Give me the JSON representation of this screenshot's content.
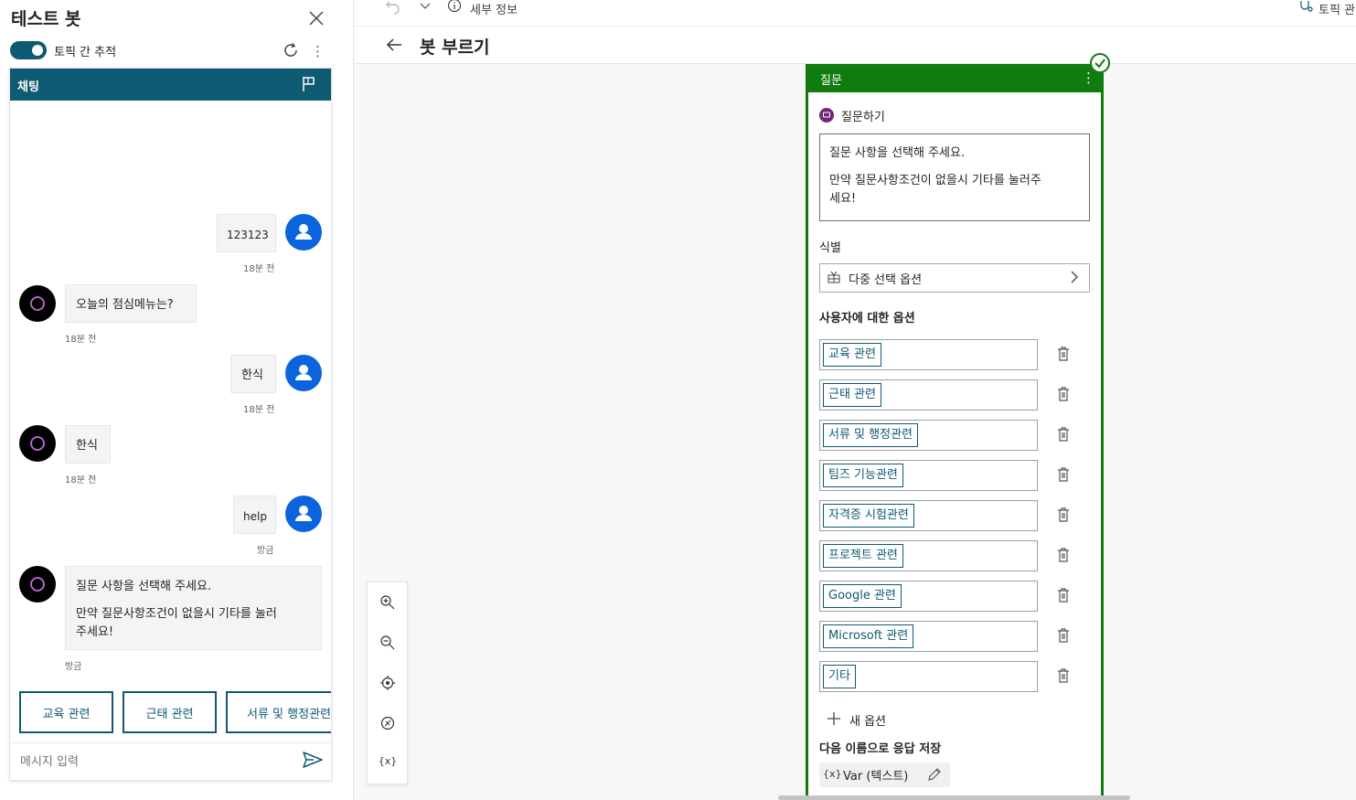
{
  "left_panel": {
    "title": "테스트 봇",
    "toggle_label": "토픽 간 추적",
    "chat_header": "채팅",
    "messages": [
      {
        "from": "user",
        "text": "123123",
        "time": "18분 전"
      },
      {
        "from": "bot",
        "text": "오늘의 점심메뉴는?",
        "time": "18분 전"
      },
      {
        "from": "user",
        "text": "한식",
        "time": "18분 전"
      },
      {
        "from": "bot",
        "text": "한식",
        "time": "18분 전"
      },
      {
        "from": "user",
        "text": "help",
        "time": "방금"
      },
      {
        "from": "bot",
        "line1": "질문 사항을 선택해 주세요.",
        "line2": "만약 질문사항조건이 없을시 기타를 눌러",
        "line3": "주세요!",
        "time": "방금"
      }
    ],
    "suggestions": [
      "교육 관련",
      "근태 관련",
      "서류 및 행정관련"
    ],
    "composer_placeholder": "메시지 입력"
  },
  "toolbar": {
    "details": "세부 정보",
    "topic_right": "토픽 관"
  },
  "page_title": "봇 부르기",
  "node": {
    "header": "질문",
    "ask_label": "질문하기",
    "message_line1": "질문 사항을 선택해 주세요.",
    "message_line2": "만약 질문사항조건이 없을시 기타를 눌러주",
    "message_line3": "세요!",
    "identify_label": "식별",
    "identify_value": "다중 선택 옵션",
    "options_label": "사용자에 대한 옵션",
    "options": [
      "교육 관련",
      "근태 관련",
      "서류 및 행정관련",
      "팀즈 기능관련",
      "자격증 시험관련",
      "프로젝트 관련",
      "Google 관련",
      "Microsoft 관련",
      "기타"
    ],
    "new_option": "새 옵션",
    "save_label": "다음 이름으로 응답 저장",
    "var_prefix": "{x}",
    "var_text": "Var (텍스트)"
  },
  "zoom_tools": {
    "var_tool": "{x}"
  },
  "colors": {
    "teal": "#0e5a73",
    "green": "#107c10",
    "user_avatar": "#0b64dd"
  }
}
